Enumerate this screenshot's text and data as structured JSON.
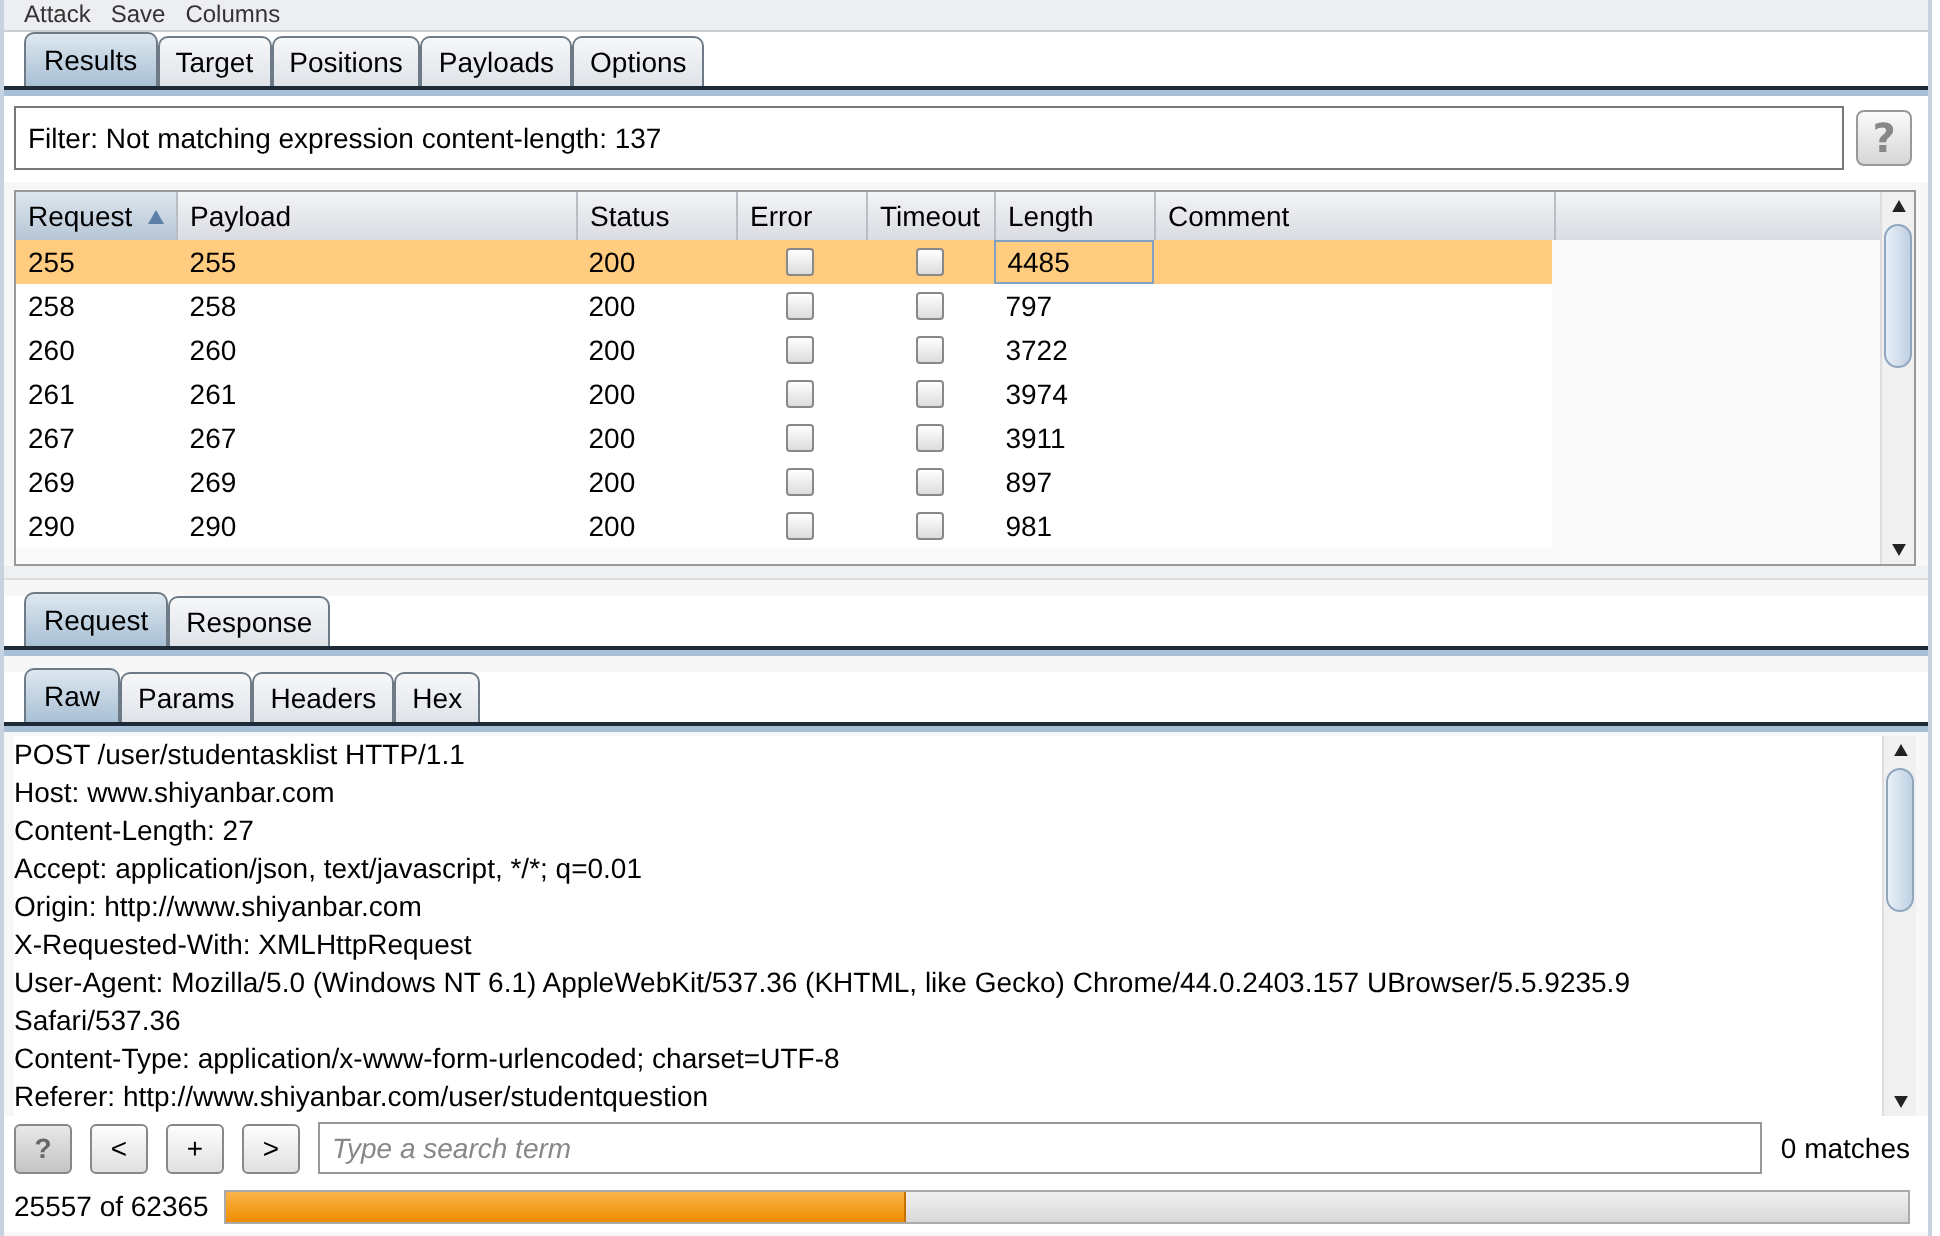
{
  "menu": [
    "Attack",
    "Save",
    "Columns"
  ],
  "tabs": [
    {
      "label": "Results",
      "selected": true
    },
    {
      "label": "Target",
      "selected": false
    },
    {
      "label": "Positions",
      "selected": false
    },
    {
      "label": "Payloads",
      "selected": false
    },
    {
      "label": "Options",
      "selected": false
    }
  ],
  "filter": {
    "text": "Filter: Not matching expression content-length: 137",
    "help": "?"
  },
  "table": {
    "columns": [
      {
        "label": "Request",
        "sorted": true
      },
      {
        "label": "Payload",
        "sorted": false
      },
      {
        "label": "Status",
        "sorted": false
      },
      {
        "label": "Error",
        "sorted": false
      },
      {
        "label": "Timeout",
        "sorted": false
      },
      {
        "label": "Length",
        "sorted": false
      },
      {
        "label": "Comment",
        "sorted": false
      }
    ],
    "rows": [
      {
        "request": "255",
        "payload": "255",
        "status": "200",
        "error": false,
        "timeout": false,
        "length": "4485",
        "comment": "",
        "selected": true
      },
      {
        "request": "258",
        "payload": "258",
        "status": "200",
        "error": false,
        "timeout": false,
        "length": "797",
        "comment": "",
        "selected": false
      },
      {
        "request": "260",
        "payload": "260",
        "status": "200",
        "error": false,
        "timeout": false,
        "length": "3722",
        "comment": "",
        "selected": false
      },
      {
        "request": "261",
        "payload": "261",
        "status": "200",
        "error": false,
        "timeout": false,
        "length": "3974",
        "comment": "",
        "selected": false
      },
      {
        "request": "267",
        "payload": "267",
        "status": "200",
        "error": false,
        "timeout": false,
        "length": "3911",
        "comment": "",
        "selected": false
      },
      {
        "request": "269",
        "payload": "269",
        "status": "200",
        "error": false,
        "timeout": false,
        "length": "897",
        "comment": "",
        "selected": false
      },
      {
        "request": "290",
        "payload": "290",
        "status": "200",
        "error": false,
        "timeout": false,
        "length": "981",
        "comment": "",
        "selected": false
      }
    ]
  },
  "message_tabs": [
    {
      "label": "Request",
      "selected": true
    },
    {
      "label": "Response",
      "selected": false
    }
  ],
  "view_tabs": [
    {
      "label": "Raw",
      "selected": true
    },
    {
      "label": "Params",
      "selected": false
    },
    {
      "label": "Headers",
      "selected": false
    },
    {
      "label": "Hex",
      "selected": false
    }
  ],
  "request_lines": [
    "POST /user/studentasklist HTTP/1.1",
    "Host: www.shiyanbar.com",
    "Content-Length: 27",
    "Accept: application/json, text/javascript, */*; q=0.01",
    "Origin: http://www.shiyanbar.com",
    "X-Requested-With: XMLHttpRequest",
    "User-Agent: Mozilla/5.0 (Windows NT 6.1) AppleWebKit/537.36 (KHTML, like Gecko) Chrome/44.0.2403.157 UBrowser/5.5.9235.9",
    "Safari/537.36",
    "Content-Type: application/x-www-form-urlencoded; charset=UTF-8",
    "Referer: http://www.shiyanbar.com/user/studentquestion"
  ],
  "search": {
    "buttons": [
      "?",
      "<",
      "+",
      ">"
    ],
    "placeholder": "Type a search term",
    "matches": "0 matches"
  },
  "progress": {
    "text": "25557 of 62365",
    "level": 0.403
  }
}
